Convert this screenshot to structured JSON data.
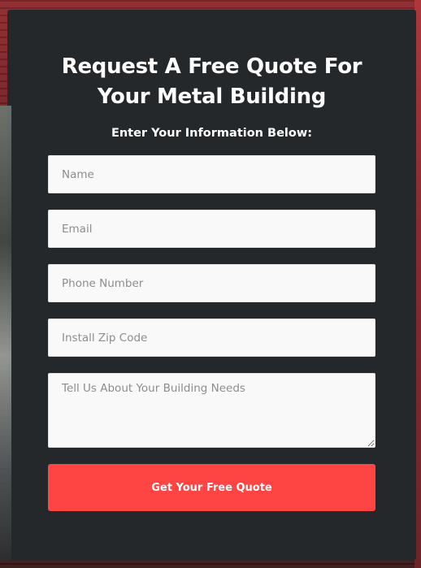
{
  "form": {
    "title": "Request A Free Quote For Your Metal Building",
    "subtitle": "Enter Your Information Below:",
    "fields": {
      "name": {
        "placeholder": "Name",
        "value": ""
      },
      "email": {
        "placeholder": "Email",
        "value": ""
      },
      "phone": {
        "placeholder": "Phone Number",
        "value": ""
      },
      "zip": {
        "placeholder": "Install Zip Code",
        "value": ""
      },
      "needs": {
        "placeholder": "Tell Us About Your Building Needs",
        "value": ""
      }
    },
    "submit_label": "Get Your Free Quote"
  },
  "colors": {
    "card_background": "#25282b",
    "accent_button": "#ff4444",
    "field_background": "#f9f9f9",
    "text_on_dark": "#ffffff"
  }
}
